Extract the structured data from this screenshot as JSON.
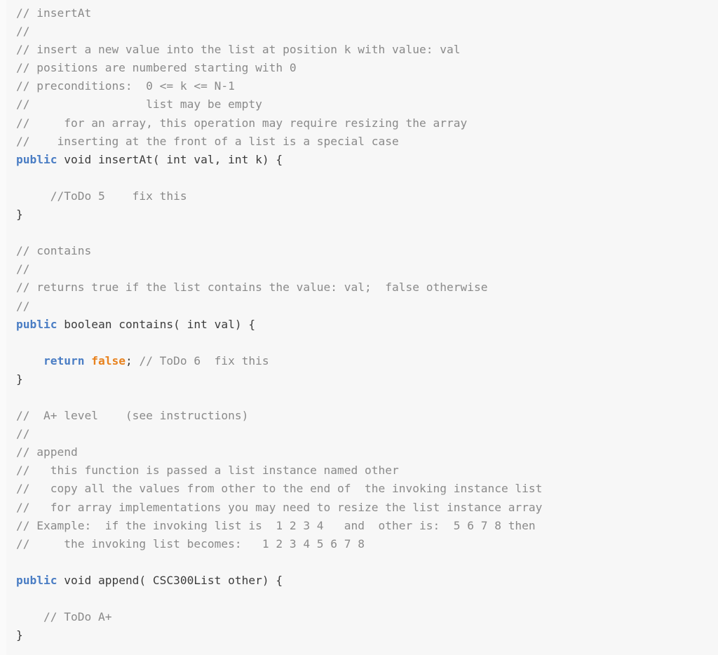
{
  "document": {
    "kind": "source-code-listing",
    "language": "Java",
    "background_color": "#f7f7f7",
    "colors": {
      "comment": "#8a8a8a",
      "keyword": "#4a7dc4",
      "literal": "#e8821e",
      "plain": "#3c3c3c",
      "background": "#f7f7f7",
      "gutter": "#fafafa"
    }
  },
  "code": {
    "lines": [
      {
        "id": 1,
        "tokens": [
          {
            "t": "cm",
            "s": "// insertAt"
          }
        ]
      },
      {
        "id": 2,
        "tokens": [
          {
            "t": "cm",
            "s": "//"
          }
        ]
      },
      {
        "id": 3,
        "tokens": [
          {
            "t": "cm",
            "s": "// insert a new value into the list at position k with value: val"
          }
        ]
      },
      {
        "id": 4,
        "tokens": [
          {
            "t": "cm",
            "s": "// positions are numbered starting with 0"
          }
        ]
      },
      {
        "id": 5,
        "tokens": [
          {
            "t": "cm",
            "s": "// preconditions:  0 <= k <= N-1"
          }
        ]
      },
      {
        "id": 6,
        "tokens": [
          {
            "t": "cm",
            "s": "//                 list may be empty"
          }
        ]
      },
      {
        "id": 7,
        "tokens": [
          {
            "t": "cm",
            "s": "//     for an array, this operation may require resizing the array"
          }
        ]
      },
      {
        "id": 8,
        "tokens": [
          {
            "t": "cm",
            "s": "//    inserting at the front of a list is a special case"
          }
        ]
      },
      {
        "id": 9,
        "tokens": [
          {
            "t": "kw",
            "s": "public"
          },
          {
            "t": "pl",
            "s": " void insertAt( int val, int k) {"
          }
        ]
      },
      {
        "id": 10,
        "tokens": []
      },
      {
        "id": 11,
        "tokens": [
          {
            "t": "cm",
            "s": "     //ToDo 5    fix this"
          }
        ]
      },
      {
        "id": 12,
        "tokens": [
          {
            "t": "pl",
            "s": "}"
          }
        ]
      },
      {
        "id": 13,
        "tokens": []
      },
      {
        "id": 14,
        "tokens": [
          {
            "t": "cm",
            "s": "// contains"
          }
        ]
      },
      {
        "id": 15,
        "tokens": [
          {
            "t": "cm",
            "s": "//"
          }
        ]
      },
      {
        "id": 16,
        "tokens": [
          {
            "t": "cm",
            "s": "// returns true if the list contains the value: val;  false otherwise"
          }
        ]
      },
      {
        "id": 17,
        "tokens": [
          {
            "t": "cm",
            "s": "//"
          }
        ]
      },
      {
        "id": 18,
        "tokens": [
          {
            "t": "kw",
            "s": "public"
          },
          {
            "t": "pl",
            "s": " boolean contains( int val) {"
          }
        ]
      },
      {
        "id": 19,
        "tokens": []
      },
      {
        "id": 20,
        "tokens": [
          {
            "t": "pl",
            "s": "    "
          },
          {
            "t": "kw",
            "s": "return"
          },
          {
            "t": "pl",
            "s": " "
          },
          {
            "t": "lit",
            "s": "false"
          },
          {
            "t": "pl",
            "s": ";"
          },
          {
            "t": "cm",
            "s": " // ToDo 6  fix this"
          }
        ]
      },
      {
        "id": 21,
        "tokens": [
          {
            "t": "pl",
            "s": "}"
          }
        ]
      },
      {
        "id": 22,
        "tokens": []
      },
      {
        "id": 23,
        "tokens": [
          {
            "t": "cm",
            "s": "//  A+ level    (see instructions)"
          }
        ]
      },
      {
        "id": 24,
        "tokens": [
          {
            "t": "cm",
            "s": "//"
          }
        ]
      },
      {
        "id": 25,
        "tokens": [
          {
            "t": "cm",
            "s": "// append"
          }
        ]
      },
      {
        "id": 26,
        "tokens": [
          {
            "t": "cm",
            "s": "//   this function is passed a list instance named other"
          }
        ]
      },
      {
        "id": 27,
        "tokens": [
          {
            "t": "cm",
            "s": "//   copy all the values from other to the end of  the invoking instance list"
          }
        ]
      },
      {
        "id": 28,
        "tokens": [
          {
            "t": "cm",
            "s": "//   for array implementations you may need to resize the list instance array"
          }
        ]
      },
      {
        "id": 29,
        "tokens": [
          {
            "t": "cm",
            "s": "// Example:  if the invoking list is  1 2 3 4   and  other is:  5 6 7 8 then"
          }
        ]
      },
      {
        "id": 30,
        "tokens": [
          {
            "t": "cm",
            "s": "//     the invoking list becomes:   1 2 3 4 5 6 7 8"
          }
        ]
      },
      {
        "id": 31,
        "tokens": []
      },
      {
        "id": 32,
        "tokens": [
          {
            "t": "kw",
            "s": "public"
          },
          {
            "t": "pl",
            "s": " void append( CSC300List other) {"
          }
        ]
      },
      {
        "id": 33,
        "tokens": []
      },
      {
        "id": 34,
        "tokens": [
          {
            "t": "cm",
            "s": "    // ToDo A+"
          }
        ]
      },
      {
        "id": 35,
        "tokens": [
          {
            "t": "pl",
            "s": "}"
          }
        ]
      }
    ]
  }
}
